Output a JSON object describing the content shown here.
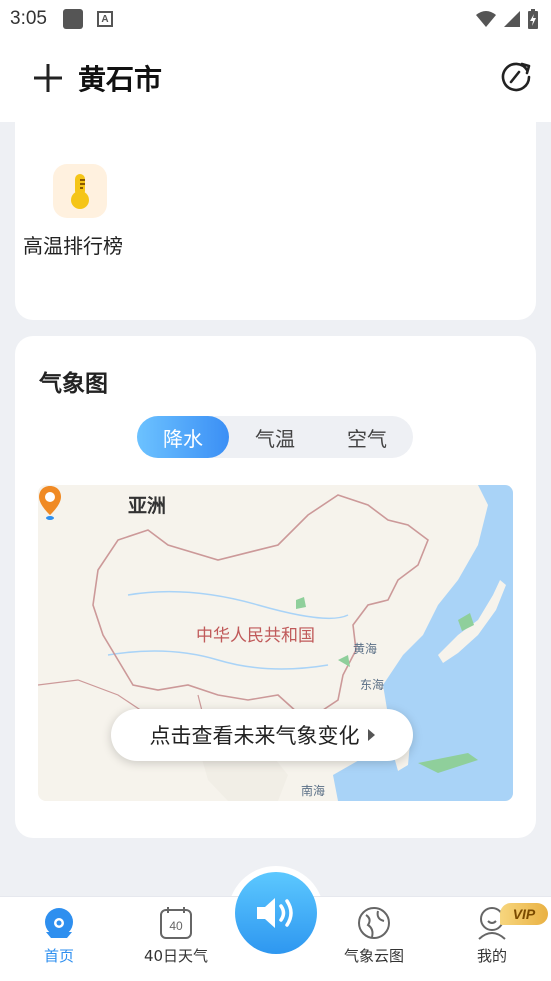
{
  "status_bar": {
    "time": "3:05"
  },
  "header": {
    "city": "黄石市"
  },
  "tools": {
    "rank_label": "高温排行榜"
  },
  "weather_map": {
    "title": "气象图",
    "tabs": [
      {
        "label": "降水",
        "active": true
      },
      {
        "label": "气温",
        "active": false
      },
      {
        "label": "空气",
        "active": false
      }
    ],
    "labels": {
      "continent": "亚洲",
      "country": "中华人民共和国",
      "yellow_sea": "黄海",
      "east_sea": "东海",
      "south_sea": "南海"
    },
    "cta": "点击查看未来气象变化"
  },
  "bottom_nav": {
    "items": [
      {
        "label": "首页",
        "active": true
      },
      {
        "label": "40日天气",
        "badge": "40"
      },
      {
        "label": "气象云图"
      },
      {
        "label": "我的",
        "badge": "VIP"
      }
    ]
  },
  "colors": {
    "accent": "#3b8ff5",
    "active_nav": "#2e8fef",
    "map_land": "#f6f3ec",
    "map_sea": "#a9d3f7",
    "border_red": "#c05a5a"
  }
}
